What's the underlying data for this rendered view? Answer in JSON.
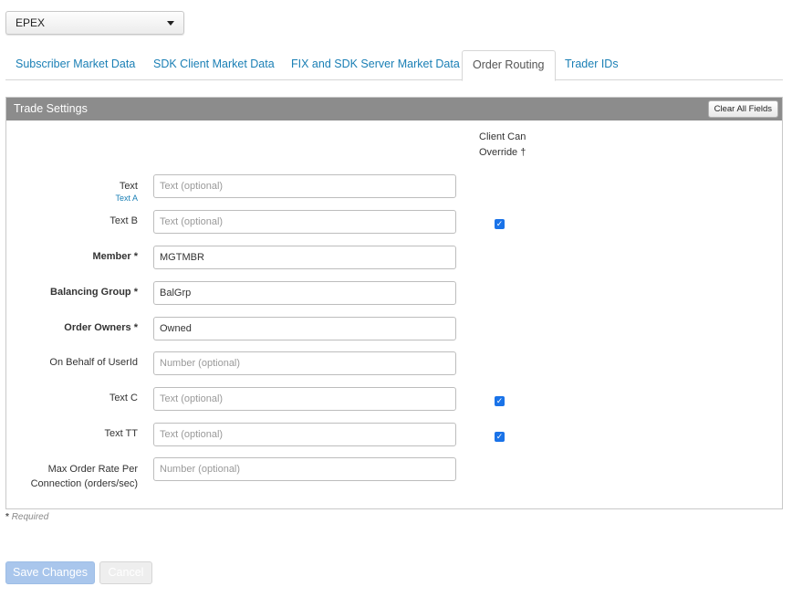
{
  "exchange": {
    "selected": "EPEX"
  },
  "tabs": [
    {
      "label": "Subscriber Market Data",
      "active": false
    },
    {
      "label": "SDK Client Market Data",
      "active": false
    },
    {
      "label": "FIX and SDK Server Market Data",
      "active": false
    },
    {
      "label": "Order Routing",
      "active": true
    },
    {
      "label": "Trader IDs",
      "active": false
    }
  ],
  "panel": {
    "title": "Trade Settings",
    "clear_label": "Clear All Fields",
    "override_header_line1": "Client Can",
    "override_header_line2": "Override †"
  },
  "fields": [
    {
      "label": "Text",
      "sublabel": "Text A",
      "value": "",
      "placeholder": "Text (optional)",
      "required": false,
      "override": false
    },
    {
      "label": "Text B",
      "value": "",
      "placeholder": "Text (optional)",
      "required": false,
      "override": true
    },
    {
      "label": "Member *",
      "value": "MGTMBR",
      "placeholder": "",
      "required": true,
      "override": false
    },
    {
      "label": "Balancing Group *",
      "value": "BalGrp",
      "placeholder": "",
      "required": true,
      "override": false
    },
    {
      "label": "Order Owners *",
      "value": "Owned",
      "placeholder": "",
      "required": true,
      "override": false
    },
    {
      "label": "On Behalf of UserId",
      "value": "",
      "placeholder": "Number (optional)",
      "required": false,
      "override": false
    },
    {
      "label": "Text C",
      "value": "",
      "placeholder": "Text (optional)",
      "required": false,
      "override": true
    },
    {
      "label": "Text TT",
      "value": "",
      "placeholder": "Text (optional)",
      "required": false,
      "override": true
    },
    {
      "label_line1": "Max Order Rate Per",
      "label_line2": "Connection (orders/sec)",
      "value": "",
      "placeholder": "Number (optional)",
      "required": false,
      "override": false
    }
  ],
  "required_note": {
    "star": "*",
    "text": "Required"
  },
  "actions": {
    "save_label": "Save Changes",
    "cancel_label": "Cancel"
  },
  "colors": {
    "accent": "#1a7fb5",
    "header_bg": "#8c8c8c",
    "checkbox": "#1a73e8",
    "save_disabled": "#a9c6ec"
  }
}
